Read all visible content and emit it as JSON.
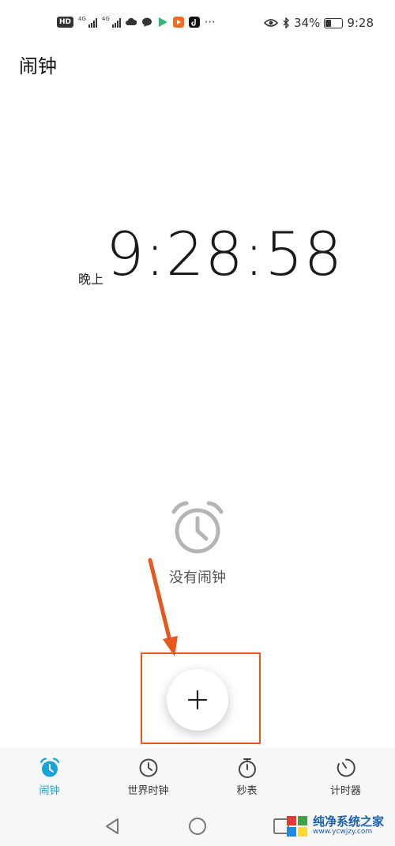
{
  "status_bar": {
    "signal_label_1": "4G",
    "signal_label_2": "4G",
    "battery_percent": "34%",
    "battery_level": 0.34,
    "time": "9:28",
    "hd_label": "HD"
  },
  "header": {
    "title": "闹钟"
  },
  "clock": {
    "ampm": "晚上",
    "time": "9:28:58"
  },
  "empty_state": {
    "message": "没有闹钟"
  },
  "nav": {
    "items": [
      {
        "label": "闹钟",
        "icon": "alarm-clock-icon",
        "active": true
      },
      {
        "label": "世界时钟",
        "icon": "world-clock-icon",
        "active": false
      },
      {
        "label": "秒表",
        "icon": "stopwatch-icon",
        "active": false
      },
      {
        "label": "计时器",
        "icon": "timer-icon",
        "active": false
      }
    ]
  },
  "watermark": {
    "title": "纯净系统之家",
    "url": "www.ycwjzy.com"
  },
  "colors": {
    "accent": "#1aa3d9",
    "annotation": "#e8571e"
  }
}
